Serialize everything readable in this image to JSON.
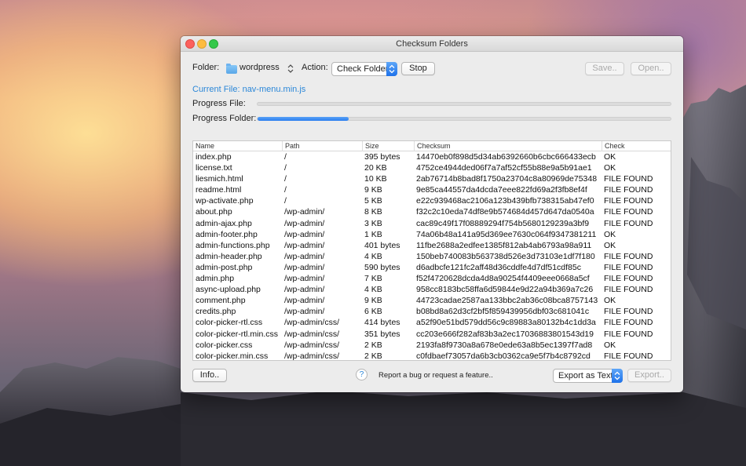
{
  "window": {
    "title": "Checksum Folders"
  },
  "toolbar": {
    "folder_label": "Folder:",
    "folder_value": "wordpress",
    "action_label": "Action:",
    "action_value": "Check Folder",
    "stop_label": "Stop",
    "save_label": "Save..",
    "open_label": "Open.."
  },
  "status": {
    "current_file": "Current File: nav-menu.min.js",
    "progress_file_label": "Progress File:",
    "progress_file_fraction": 0.0,
    "progress_folder_label": "Progress Folder:",
    "progress_folder_fraction": 0.22
  },
  "table": {
    "columns": [
      "Name",
      "Path",
      "Size",
      "Checksum",
      "Check"
    ],
    "rows": [
      [
        "index.php",
        "/",
        "395 bytes",
        "14470eb0f898d5d34ab6392660b6cbc666433ecb",
        "OK"
      ],
      [
        "license.txt",
        "/",
        "20 KB",
        "4752ce4944ded06f7a7af52cf55b88e9a5b91ae1",
        "OK"
      ],
      [
        "liesmich.html",
        "/",
        "10 KB",
        "2ab76714b8bad8f1750a23704c8a80969de75348",
        "FILE FOUND"
      ],
      [
        "readme.html",
        "/",
        "9 KB",
        "9e85ca44557da4dcda7eee822fd69a2f3fb8ef4f",
        "FILE FOUND"
      ],
      [
        "wp-activate.php",
        "/",
        "5 KB",
        "e22c939468ac2106a123b439bfb738315ab47ef0",
        "FILE FOUND"
      ],
      [
        "about.php",
        "/wp-admin/",
        "8 KB",
        "f32c2c10eda74df8e9b574684d457d647da0540a",
        "FILE FOUND"
      ],
      [
        "admin-ajax.php",
        "/wp-admin/",
        "3 KB",
        "cac89c49f17f08889294f754b5680129239a3bf9",
        "FILE FOUND"
      ],
      [
        "admin-footer.php",
        "/wp-admin/",
        "1 KB",
        "74a06b48a141a95d369ee7630c064f9347381211",
        "OK"
      ],
      [
        "admin-functions.php",
        "/wp-admin/",
        "401 bytes",
        "11fbe2688a2edfee1385f812ab4ab6793a98a911",
        "OK"
      ],
      [
        "admin-header.php",
        "/wp-admin/",
        "4 KB",
        "150beb740083b563738d526e3d73103e1df7f180",
        "FILE FOUND"
      ],
      [
        "admin-post.php",
        "/wp-admin/",
        "590 bytes",
        "d6adbcfe121fc2aff48d36cddfe4d7df51cdf85c",
        "FILE FOUND"
      ],
      [
        "admin.php",
        "/wp-admin/",
        "7 KB",
        "f52f4720628dcda4d8a90254f4409eee0668a5cf",
        "FILE FOUND"
      ],
      [
        "async-upload.php",
        "/wp-admin/",
        "4 KB",
        "958cc8183bc58ffa6d59844e9d22a94b369a7c26",
        "FILE FOUND"
      ],
      [
        "comment.php",
        "/wp-admin/",
        "9 KB",
        "44723cadae2587aa133bbc2ab36c08bca8757143",
        "OK"
      ],
      [
        "credits.php",
        "/wp-admin/",
        "6 KB",
        "b08bd8a62d3cf2bf5f859439956dbf03c681041c",
        "FILE FOUND"
      ],
      [
        "color-picker-rtl.css",
        "/wp-admin/css/",
        "414 bytes",
        "a52f90e51bd579dd56c9c89883a80132b4c1dd3a",
        "FILE FOUND"
      ],
      [
        "color-picker-rtl.min.css",
        "/wp-admin/css/",
        "351 bytes",
        "cc203e666f282af83b3a2ec17036883801543d19",
        "FILE FOUND"
      ],
      [
        "color-picker.css",
        "/wp-admin/css/",
        "2 KB",
        "2193fa8f9730a8a678e0ede63a8b5ec1397f7ad8",
        "OK"
      ],
      [
        "color-picker.min.css",
        "/wp-admin/css/",
        "2 KB",
        "c0fdbaef73057da6b3cb0362ca9e5f7b4c8792cd",
        "FILE FOUND"
      ]
    ]
  },
  "footer": {
    "info_label": "Info..",
    "help_glyph": "?",
    "report_text": "Report a bug or request a feature..",
    "export_format": "Export as Text",
    "export_label": "Export.."
  },
  "icons": [
    "close-icon",
    "minimize-icon",
    "zoom-icon",
    "folder-icon",
    "updown-chevron-icon",
    "help-icon"
  ],
  "colors": {
    "accent": "#2b7ef0",
    "link": "#2b87d8"
  }
}
